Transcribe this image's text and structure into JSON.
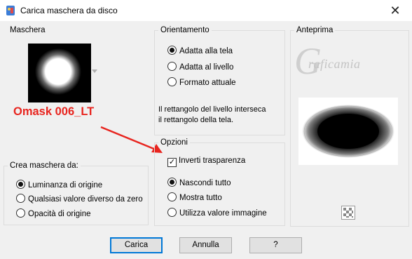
{
  "window": {
    "title": "Carica maschera da disco",
    "close_glyph": "✕"
  },
  "maschera": {
    "label": "Maschera",
    "annotation": "Omask 006_LT",
    "annotation_color": "#e8251f"
  },
  "crea": {
    "label": "Crea maschera da:",
    "options": [
      "Luminanza di origine",
      "Qualsiasi valore diverso da zero",
      "Opacità di origine"
    ],
    "selected": 0
  },
  "orientamento": {
    "label": "Orientamento",
    "options": [
      "Adatta alla tela",
      "Adatta al livello",
      "Formato attuale"
    ],
    "selected": 0,
    "info_line1": "Il rettangolo del livello interseca",
    "info_line2": "il rettangolo della tela."
  },
  "opzioni": {
    "label": "Opzioni",
    "invert_label": "Inverti trasparenza",
    "invert_checked": true,
    "options": [
      "Nascondi tutto",
      "Mostra tutto",
      "Utilizza valore immagine"
    ],
    "selected": 0
  },
  "anteprima": {
    "label": "Anteprima",
    "watermark": "Graficamia",
    "checker_icon": "checkerboard-icon"
  },
  "buttons": {
    "ok": "Carica",
    "cancel": "Annulla",
    "help": "?"
  },
  "colors": {
    "accent": "#0078d7",
    "annotation": "#e8251f"
  }
}
